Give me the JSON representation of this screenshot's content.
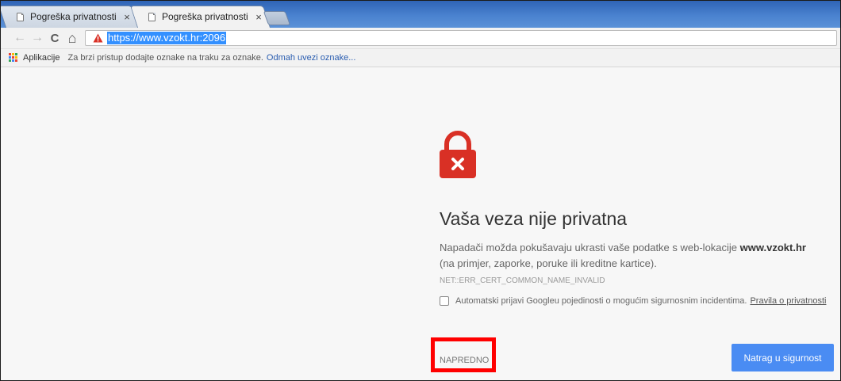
{
  "tabs": [
    {
      "title": "Pogreška privatnosti",
      "close": "×",
      "active": false
    },
    {
      "title": "Pogreška privatnosti",
      "close": "×",
      "active": true
    }
  ],
  "toolbar": {
    "back_glyph": "←",
    "forward_glyph": "→",
    "reload_glyph": "C",
    "home_glyph": "⌂",
    "url": "https://www.vzokt.hr:2096",
    "security_icon": "warning-triangle-icon"
  },
  "bookmarks": {
    "apps_label": "Aplikacije",
    "hint": "Za brzi pristup dodajte oznake na traku za oznake.",
    "import_link": "Odmah uvezi oznake..."
  },
  "interstitial": {
    "icon": "lock-error-icon",
    "heading": "Vaša veza nije privatna",
    "description_before": "Napadači možda pokušavaju ukrasti vaše podatke s web-lokacije",
    "domain": "www.vzokt.hr",
    "description_after": "(na primjer, zaporke, poruke ili kreditne kartice).",
    "error_code": "NET::ERR_CERT_COMMON_NAME_INVALID",
    "report_checkbox_label": "Automatski prijavi Googleu pojedinosti o mogućim sigurnosnim incidentima.",
    "privacy_link": "Pravila o privatnosti",
    "advanced_label": "NAPREDNO",
    "back_button_label": "Natrag u sigurnost"
  },
  "colors": {
    "primary_button": "#4a8cf3",
    "lock_red": "#d93025",
    "highlight_box": "#ff0000",
    "tabstrip": "#4a82cf"
  }
}
